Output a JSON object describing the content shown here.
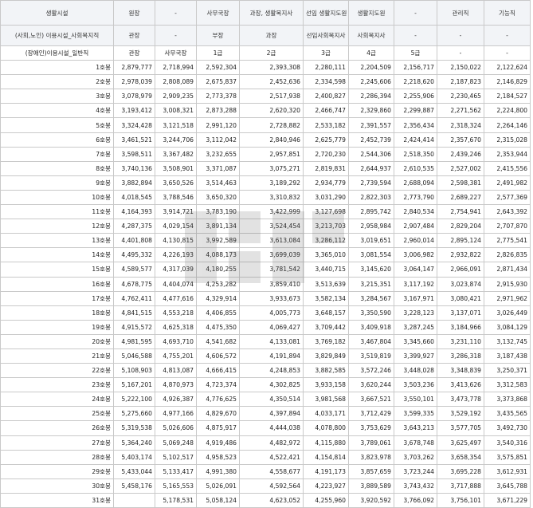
{
  "header": {
    "row1": [
      "생활시설",
      "원장",
      "-",
      "사무국장",
      "과장, 생활복지사",
      "선임 생활지도원",
      "생활지도원",
      "-",
      "관리직",
      "기능직"
    ],
    "row2": [
      "(사회,노인) 이용시설_사회복지직",
      "관장",
      "-",
      "부장",
      "과장",
      "선임사회복지사",
      "사회복지사",
      "-",
      "-",
      "-"
    ],
    "row3": [
      "(장애인)이용시설_일반직",
      "관장",
      "사무국장",
      "1급",
      "2급",
      "3급",
      "4급",
      "5급",
      "-",
      "-"
    ]
  },
  "rows": [
    {
      "grade": "1호봉",
      "v": [
        "2,879,777",
        "2,718,994",
        "2,592,304",
        "2,393,308",
        "2,280,111",
        "2,204,509",
        "2,156,717",
        "2,150,022",
        "2,122,624"
      ]
    },
    {
      "grade": "2호봉",
      "v": [
        "2,978,039",
        "2,808,089",
        "2,675,837",
        "2,452,636",
        "2,334,598",
        "2,245,606",
        "2,218,620",
        "2,187,823",
        "2,146,829"
      ]
    },
    {
      "grade": "3호봉",
      "v": [
        "3,078,979",
        "2,909,235",
        "2,773,378",
        "2,517,938",
        "2,400,827",
        "2,286,394",
        "2,255,906",
        "2,230,465",
        "2,184,527"
      ]
    },
    {
      "grade": "4호봉",
      "v": [
        "3,193,412",
        "3,008,321",
        "2,873,288",
        "2,620,320",
        "2,466,747",
        "2,329,860",
        "2,299,887",
        "2,271,562",
        "2,224,800"
      ]
    },
    {
      "grade": "5호봉",
      "v": [
        "3,324,428",
        "3,121,518",
        "2,991,120",
        "2,728,882",
        "2,533,182",
        "2,391,557",
        "2,356,434",
        "2,318,324",
        "2,264,146"
      ]
    },
    {
      "grade": "6호봉",
      "v": [
        "3,461,521",
        "3,244,706",
        "3,112,042",
        "2,840,946",
        "2,625,779",
        "2,452,739",
        "2,424,414",
        "2,357,670",
        "2,315,028"
      ]
    },
    {
      "grade": "7호봉",
      "v": [
        "3,598,511",
        "3,367,482",
        "3,232,655",
        "2,957,851",
        "2,720,230",
        "2,544,306",
        "2,518,350",
        "2,439,246",
        "2,353,944"
      ]
    },
    {
      "grade": "8호봉",
      "v": [
        "3,740,136",
        "3,508,901",
        "3,371,087",
        "3,075,271",
        "2,819,831",
        "2,644,937",
        "2,610,535",
        "2,527,002",
        "2,415,556"
      ]
    },
    {
      "grade": "9호봉",
      "v": [
        "3,882,894",
        "3,650,526",
        "3,514,463",
        "3,189,292",
        "2,934,779",
        "2,739,594",
        "2,688,094",
        "2,598,381",
        "2,491,982"
      ]
    },
    {
      "grade": "10호봉",
      "v": [
        "4,018,545",
        "3,788,546",
        "3,650,320",
        "3,310,832",
        "3,031,290",
        "2,822,303",
        "2,773,790",
        "2,689,227",
        "2,577,369"
      ]
    },
    {
      "grade": "11호봉",
      "v": [
        "4,164,393",
        "3,914,721",
        "3,783,190",
        "3,422,999",
        "3,127,698",
        "2,895,742",
        "2,840,534",
        "2,754,941",
        "2,643,392"
      ]
    },
    {
      "grade": "12호봉",
      "v": [
        "4,287,375",
        "4,029,154",
        "3,891,134",
        "3,524,454",
        "3,213,703",
        "2,958,984",
        "2,907,484",
        "2,829,204",
        "2,707,870"
      ]
    },
    {
      "grade": "13호봉",
      "v": [
        "4,401,808",
        "4,130,815",
        "3,992,589",
        "3,613,084",
        "3,286,112",
        "3,019,651",
        "2,960,014",
        "2,895,124",
        "2,775,541"
      ]
    },
    {
      "grade": "14호봉",
      "v": [
        "4,495,332",
        "4,226,193",
        "4,088,173",
        "3,699,039",
        "3,365,010",
        "3,081,554",
        "3,006,982",
        "2,932,822",
        "2,826,835"
      ]
    },
    {
      "grade": "15호봉",
      "v": [
        "4,589,577",
        "4,317,039",
        "4,180,255",
        "3,781,542",
        "3,440,715",
        "3,145,620",
        "3,064,147",
        "2,966,091",
        "2,871,434"
      ]
    },
    {
      "grade": "16호봉",
      "v": [
        "4,678,775",
        "4,404,074",
        "4,253,282",
        "3,859,410",
        "3,513,639",
        "3,215,351",
        "3,117,192",
        "3,023,874",
        "2,915,930"
      ]
    },
    {
      "grade": "17호봉",
      "v": [
        "4,762,411",
        "4,477,616",
        "4,329,914",
        "3,933,673",
        "3,582,134",
        "3,284,567",
        "3,167,971",
        "3,080,421",
        "2,971,962"
      ]
    },
    {
      "grade": "18호봉",
      "v": [
        "4,841,515",
        "4,553,218",
        "4,406,855",
        "4,005,773",
        "3,648,157",
        "3,350,590",
        "3,228,123",
        "3,137,071",
        "3,026,449"
      ]
    },
    {
      "grade": "19호봉",
      "v": [
        "4,915,572",
        "4,625,318",
        "4,475,350",
        "4,069,427",
        "3,709,442",
        "3,409,918",
        "3,287,245",
        "3,184,966",
        "3,084,129"
      ]
    },
    {
      "grade": "20호봉",
      "v": [
        "4,981,595",
        "4,693,710",
        "4,541,682",
        "4,133,081",
        "3,769,182",
        "3,467,804",
        "3,345,660",
        "3,231,110",
        "3,132,745"
      ]
    },
    {
      "grade": "21호봉",
      "v": [
        "5,046,588",
        "4,755,201",
        "4,606,572",
        "4,191,894",
        "3,829,849",
        "3,519,819",
        "3,399,927",
        "3,286,318",
        "3,187,438"
      ]
    },
    {
      "grade": "22호봉",
      "v": [
        "5,108,903",
        "4,813,087",
        "4,666,415",
        "4,248,853",
        "3,882,585",
        "3,572,246",
        "3,448,028",
        "3,348,839",
        "3,250,371"
      ]
    },
    {
      "grade": "23호봉",
      "v": [
        "5,167,201",
        "4,870,973",
        "4,723,374",
        "4,302,825",
        "3,933,158",
        "3,620,244",
        "3,503,236",
        "3,413,626",
        "3,312,583"
      ]
    },
    {
      "grade": "24호봉",
      "v": [
        "5,222,100",
        "4,926,387",
        "4,776,625",
        "4,350,514",
        "3,981,568",
        "3,667,521",
        "3,550,101",
        "3,473,778",
        "3,373,868"
      ]
    },
    {
      "grade": "25호봉",
      "v": [
        "5,275,660",
        "4,977,166",
        "4,829,670",
        "4,397,894",
        "4,033,171",
        "3,712,429",
        "3,599,335",
        "3,529,192",
        "3,435,565"
      ]
    },
    {
      "grade": "26호봉",
      "v": [
        "5,319,538",
        "5,026,606",
        "4,875,917",
        "4,444,038",
        "4,078,800",
        "3,753,629",
        "3,643,213",
        "3,577,705",
        "3,492,730"
      ]
    },
    {
      "grade": "27호봉",
      "v": [
        "5,364,240",
        "5,069,248",
        "4,919,486",
        "4,482,972",
        "4,115,880",
        "3,789,061",
        "3,678,748",
        "3,625,497",
        "3,540,316"
      ]
    },
    {
      "grade": "28호봉",
      "v": [
        "5,403,174",
        "5,102,517",
        "4,958,523",
        "4,522,421",
        "4,154,814",
        "3,823,978",
        "3,703,262",
        "3,658,354",
        "3,575,851"
      ]
    },
    {
      "grade": "29호봉",
      "v": [
        "5,433,044",
        "5,133,417",
        "4,991,380",
        "4,558,677",
        "4,191,173",
        "3,857,659",
        "3,723,244",
        "3,695,228",
        "3,612,931"
      ]
    },
    {
      "grade": "30호봉",
      "v": [
        "5,458,176",
        "5,165,553",
        "5,026,091",
        "4,592,564",
        "4,223,927",
        "3,889,589",
        "3,743,432",
        "3,717,888",
        "3,645,788"
      ]
    },
    {
      "grade": "31호봉",
      "v": [
        "",
        "5,178,531",
        "5,058,124",
        "4,623,052",
        "4,255,960",
        "3,920,592",
        "3,766,092",
        "3,756,101",
        "3,671,229"
      ]
    }
  ]
}
